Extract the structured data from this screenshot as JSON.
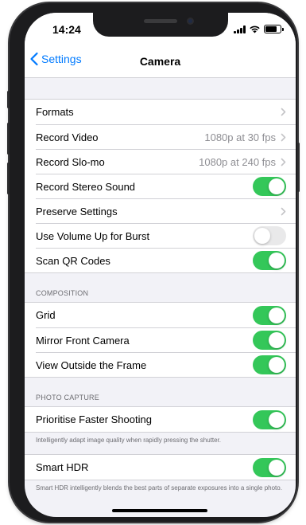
{
  "status": {
    "time": "14:24"
  },
  "nav": {
    "back_label": "Settings",
    "title": "Camera"
  },
  "group1": {
    "rows": [
      {
        "label": "Formats",
        "detail": "",
        "control": "chevron"
      },
      {
        "label": "Record Video",
        "detail": "1080p at 30 fps",
        "control": "chevron"
      },
      {
        "label": "Record Slo-mo",
        "detail": "1080p at 240 fps",
        "control": "chevron"
      },
      {
        "label": "Record Stereo Sound",
        "control": "toggle",
        "on": true
      },
      {
        "label": "Preserve Settings",
        "detail": "",
        "control": "chevron"
      },
      {
        "label": "Use Volume Up for Burst",
        "control": "toggle",
        "on": false
      },
      {
        "label": "Scan QR Codes",
        "control": "toggle",
        "on": true
      }
    ]
  },
  "composition": {
    "header": "COMPOSITION",
    "rows": [
      {
        "label": "Grid",
        "control": "toggle",
        "on": true
      },
      {
        "label": "Mirror Front Camera",
        "control": "toggle",
        "on": true
      },
      {
        "label": "View Outside the Frame",
        "control": "toggle",
        "on": true
      }
    ]
  },
  "photo_capture": {
    "header": "PHOTO CAPTURE",
    "rows": [
      {
        "label": "Prioritise Faster Shooting",
        "control": "toggle",
        "on": true
      }
    ],
    "footer": "Intelligently adapt image quality when rapidly pressing the shutter."
  },
  "smart_hdr": {
    "rows": [
      {
        "label": "Smart HDR",
        "control": "toggle",
        "on": true
      }
    ],
    "footer": "Smart HDR intelligently blends the best parts of separate exposures into a single photo."
  },
  "colors": {
    "accent": "#007aff",
    "toggle_on": "#34c759",
    "toggle_off": "#e9e9ea"
  },
  "icons": {
    "back": "chevron-left-icon",
    "chevron": "chevron-right-icon"
  }
}
